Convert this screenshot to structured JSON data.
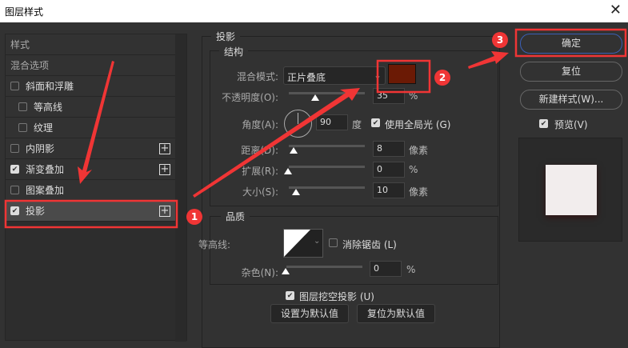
{
  "window": {
    "title": "图层样式",
    "close_icon": "close-icon"
  },
  "left": {
    "header": "样式",
    "blend_options": "混合选项",
    "items": [
      {
        "label": "斜面和浮雕",
        "checked": false,
        "plus": false
      },
      {
        "label": "等高线",
        "checked": false,
        "plus": false
      },
      {
        "label": "纹理",
        "checked": false,
        "plus": false
      },
      {
        "label": "内阴影",
        "checked": false,
        "plus": true
      },
      {
        "label": "渐变叠加",
        "checked": true,
        "plus": true
      },
      {
        "label": "图案叠加",
        "checked": false,
        "plus": false
      },
      {
        "label": "投影",
        "checked": true,
        "plus": true,
        "selected": true
      }
    ]
  },
  "drop_shadow": {
    "title": "投影",
    "structure": {
      "title": "结构",
      "blend_mode_label": "混合模式:",
      "blend_mode": "正片叠底",
      "color": "#6b1a05",
      "opacity_label": "不透明度(O):",
      "opacity": "35",
      "opacity_unit": "%",
      "angle_label": "角度(A):",
      "angle": "90",
      "angle_unit": "度",
      "global_light_label": "使用全局光 (G)",
      "global_light": true,
      "distance_label": "距离(D):",
      "distance": "8",
      "distance_unit": "像素",
      "spread_label": "扩展(R):",
      "spread": "0",
      "spread_unit": "%",
      "size_label": "大小(S):",
      "size": "10",
      "size_unit": "像素"
    },
    "quality": {
      "title": "品质",
      "contour_label": "等高线:",
      "antialias_label": "消除锯齿 (L)",
      "antialias": false,
      "noise_label": "杂色(N):",
      "noise": "0",
      "noise_unit": "%"
    },
    "knockout_label": "图层挖空投影 (U)",
    "knockout": true,
    "set_default": "设置为默认值",
    "reset_default": "复位为默认值"
  },
  "right": {
    "ok": "确定",
    "reset": "复位",
    "new_style": "新建样式(W)...",
    "preview_label": "预览(V)",
    "preview": true
  },
  "annotations": {
    "n1": "1",
    "n2": "2",
    "n3": "3",
    "color": "#f03535"
  }
}
